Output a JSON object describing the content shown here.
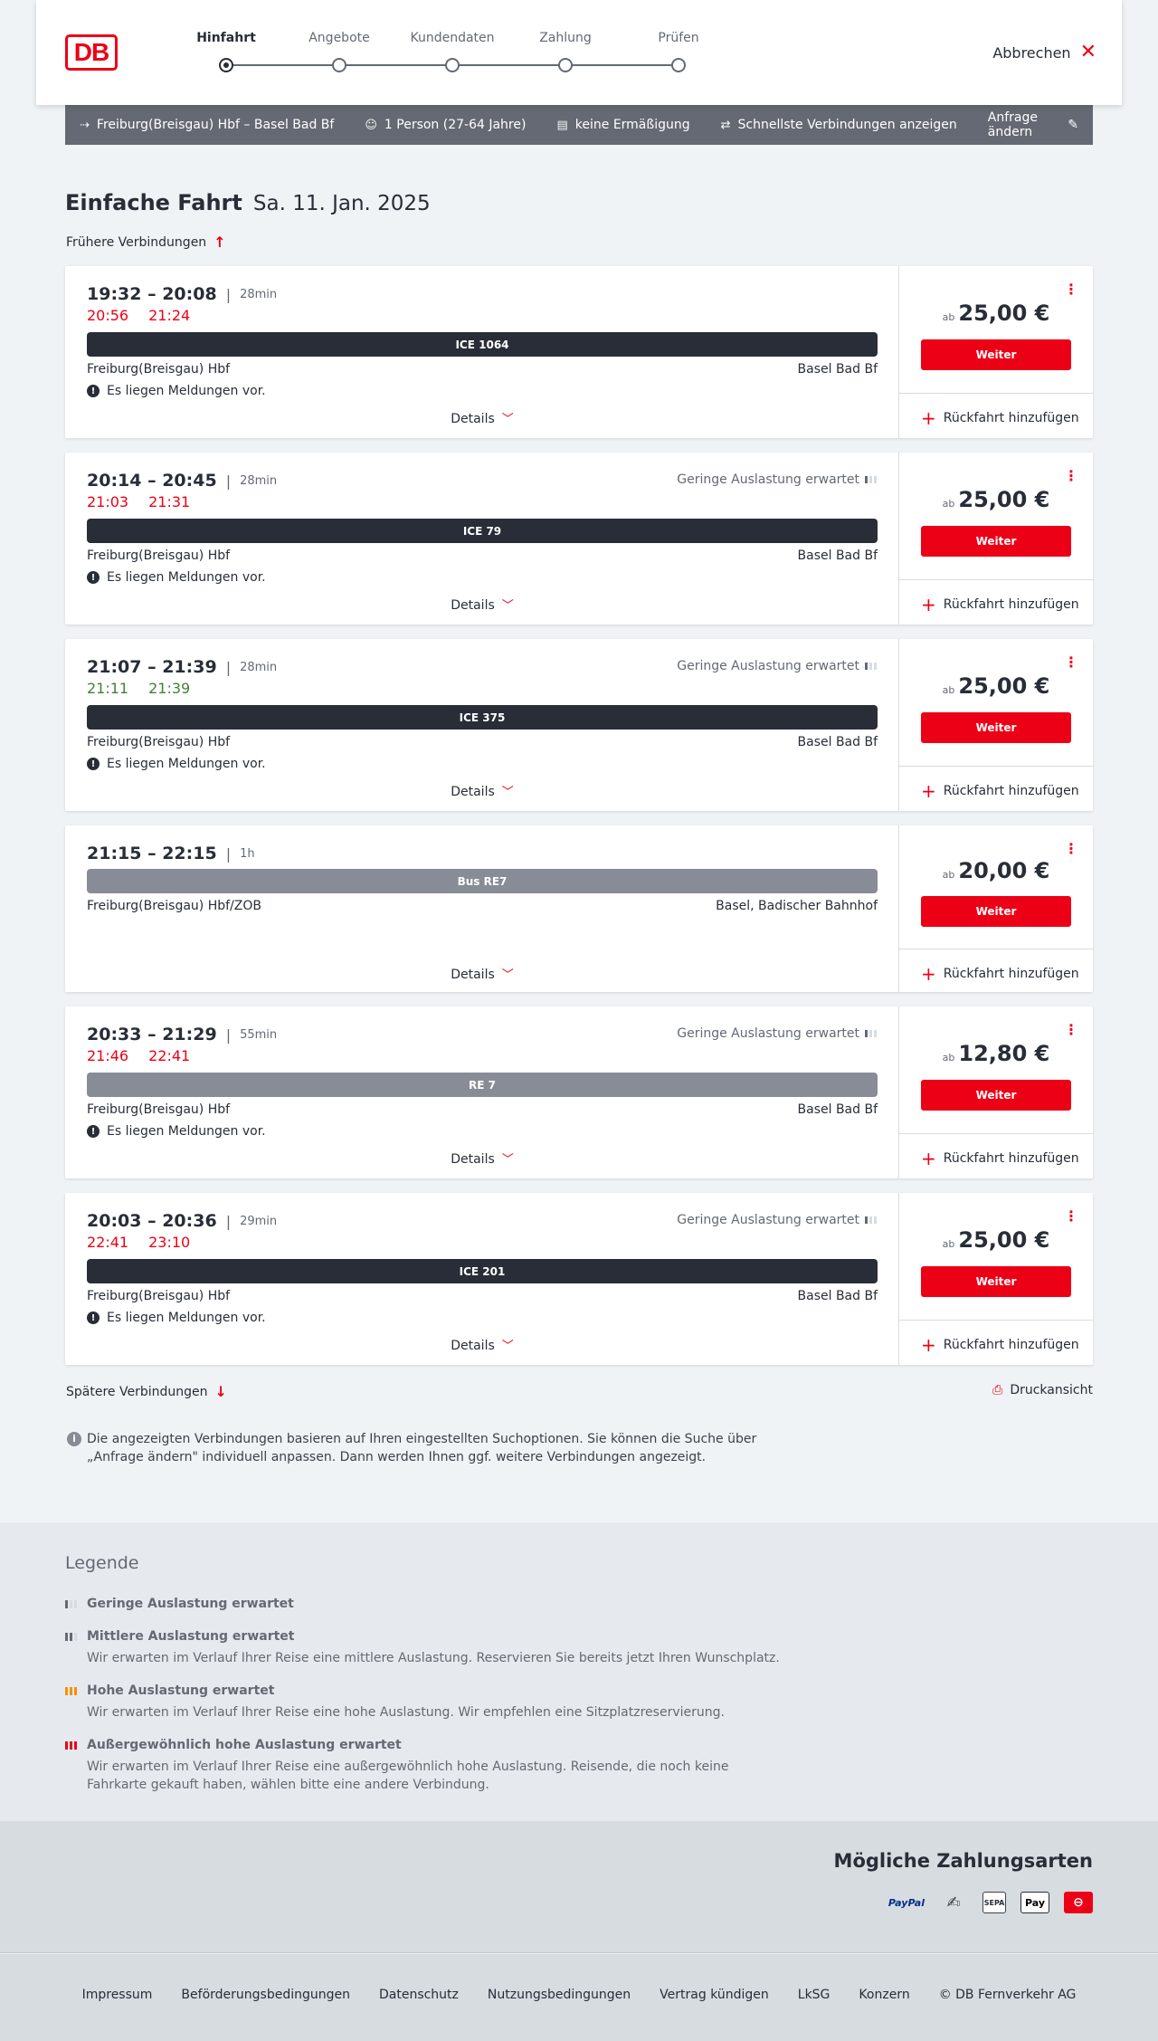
{
  "header": {
    "logo_text": "DB",
    "steps": [
      "Hinfahrt",
      "Angebote",
      "Kundendaten",
      "Zahlung",
      "Prüfen"
    ],
    "cancel_label": "Abbrechen"
  },
  "searchbar": {
    "route": "Freiburg(Breisgau) Hbf – Basel Bad Bf",
    "passengers": "1 Person (27-64 Jahre)",
    "discount": "keine Ermäßigung",
    "option": "Schnellste Verbindungen anzeigen",
    "edit_label": "Anfrage ändern"
  },
  "page": {
    "title": "Einfache Fahrt",
    "date": "Sa. 11. Jan. 2025",
    "earlier": "Frühere Verbindungen",
    "later": "Spätere Verbindungen",
    "print": "Druckansicht",
    "info": "Die angezeigten Verbindungen basieren auf Ihren eingestellten Suchoptionen. Sie können die Suche über „Anfrage ändern\" individuell anpassen. Dann werden Ihnen ggf. weitere Verbindungen angezeigt."
  },
  "common": {
    "details": "Details",
    "weiter": "Weiter",
    "return": "Rückfahrt hinzufügen",
    "price_prefix": "ab",
    "notice": "Es liegen Meldungen vor.",
    "occupancy": "Geringe Auslastung erwartet"
  },
  "connections": [
    {
      "times": "19:32 – 20:08",
      "duration": "28min",
      "rt_dep": "20:56",
      "rt_arr": "21:24",
      "train": "ICE 1064",
      "from": "Freiburg(Breisgau) Hbf",
      "to": "Basel Bad Bf",
      "price": "25,00 €"
    },
    {
      "times": "20:14 – 20:45",
      "duration": "28min",
      "rt_dep": "21:03",
      "rt_arr": "21:31",
      "train": "ICE 79",
      "from": "Freiburg(Breisgau) Hbf",
      "to": "Basel Bad Bf",
      "price": "25,00 €"
    },
    {
      "times": "21:07 – 21:39",
      "duration": "28min",
      "rt_dep": "21:11",
      "rt_arr": "21:39",
      "train": "ICE 375",
      "from": "Freiburg(Breisgau) Hbf",
      "to": "Basel Bad Bf",
      "price": "25,00 €"
    },
    {
      "times": "21:15 – 22:15",
      "duration": "1h",
      "train": "Bus RE7",
      "from": "Freiburg(Breisgau) Hbf/ZOB",
      "to": "Basel, Badischer Bahnhof",
      "price": "20,00 €"
    },
    {
      "times": "20:33 – 21:29",
      "duration": "55min",
      "rt_dep": "21:46",
      "rt_arr": "22:41",
      "train": "RE 7",
      "from": "Freiburg(Breisgau) Hbf",
      "to": "Basel Bad Bf",
      "price": "12,80 €"
    },
    {
      "times": "20:03 – 20:36",
      "duration": "29min",
      "rt_dep": "22:41",
      "rt_arr": "23:10",
      "train": "ICE 201",
      "from": "Freiburg(Breisgau) Hbf",
      "to": "Basel Bad Bf",
      "price": "25,00 €"
    }
  ],
  "legend": {
    "title": "Legende",
    "items": [
      {
        "title": "Geringe Auslastung erwartet",
        "desc": ""
      },
      {
        "title": "Mittlere Auslastung erwartet",
        "desc": "Wir erwarten im Verlauf Ihrer Reise eine mittlere Auslastung. Reservieren Sie bereits jetzt Ihren Wunschplatz."
      },
      {
        "title": "Hohe Auslastung erwartet",
        "desc": "Wir erwarten im Verlauf Ihrer Reise eine hohe Auslastung. Wir empfehlen eine Sitzplatzreservierung."
      },
      {
        "title": "Außergewöhnlich hohe Auslastung erwartet",
        "desc": "Wir erwarten im Verlauf Ihrer Reise eine außergewöhnlich hohe Auslastung. Reisende, die noch keine Fahrkarte gekauft haben, wählen bitte eine andere Verbindung."
      }
    ]
  },
  "payment": {
    "title": "Mögliche Zahlungsarten",
    "paypal": "PayPal",
    "sepa": "SEPA",
    "applepay": "Pay"
  },
  "footer": {
    "links": [
      "Impressum",
      "Beförderungsbedingungen",
      "Datenschutz",
      "Nutzungsbedingungen",
      "Vertrag kündigen",
      "LkSG",
      "Konzern",
      "© DB Fernverkehr AG"
    ]
  },
  "colors": {
    "brand": "#ec0016",
    "delay": "#ec0016",
    "ontime": "#408335",
    "dark": "#282d37"
  }
}
